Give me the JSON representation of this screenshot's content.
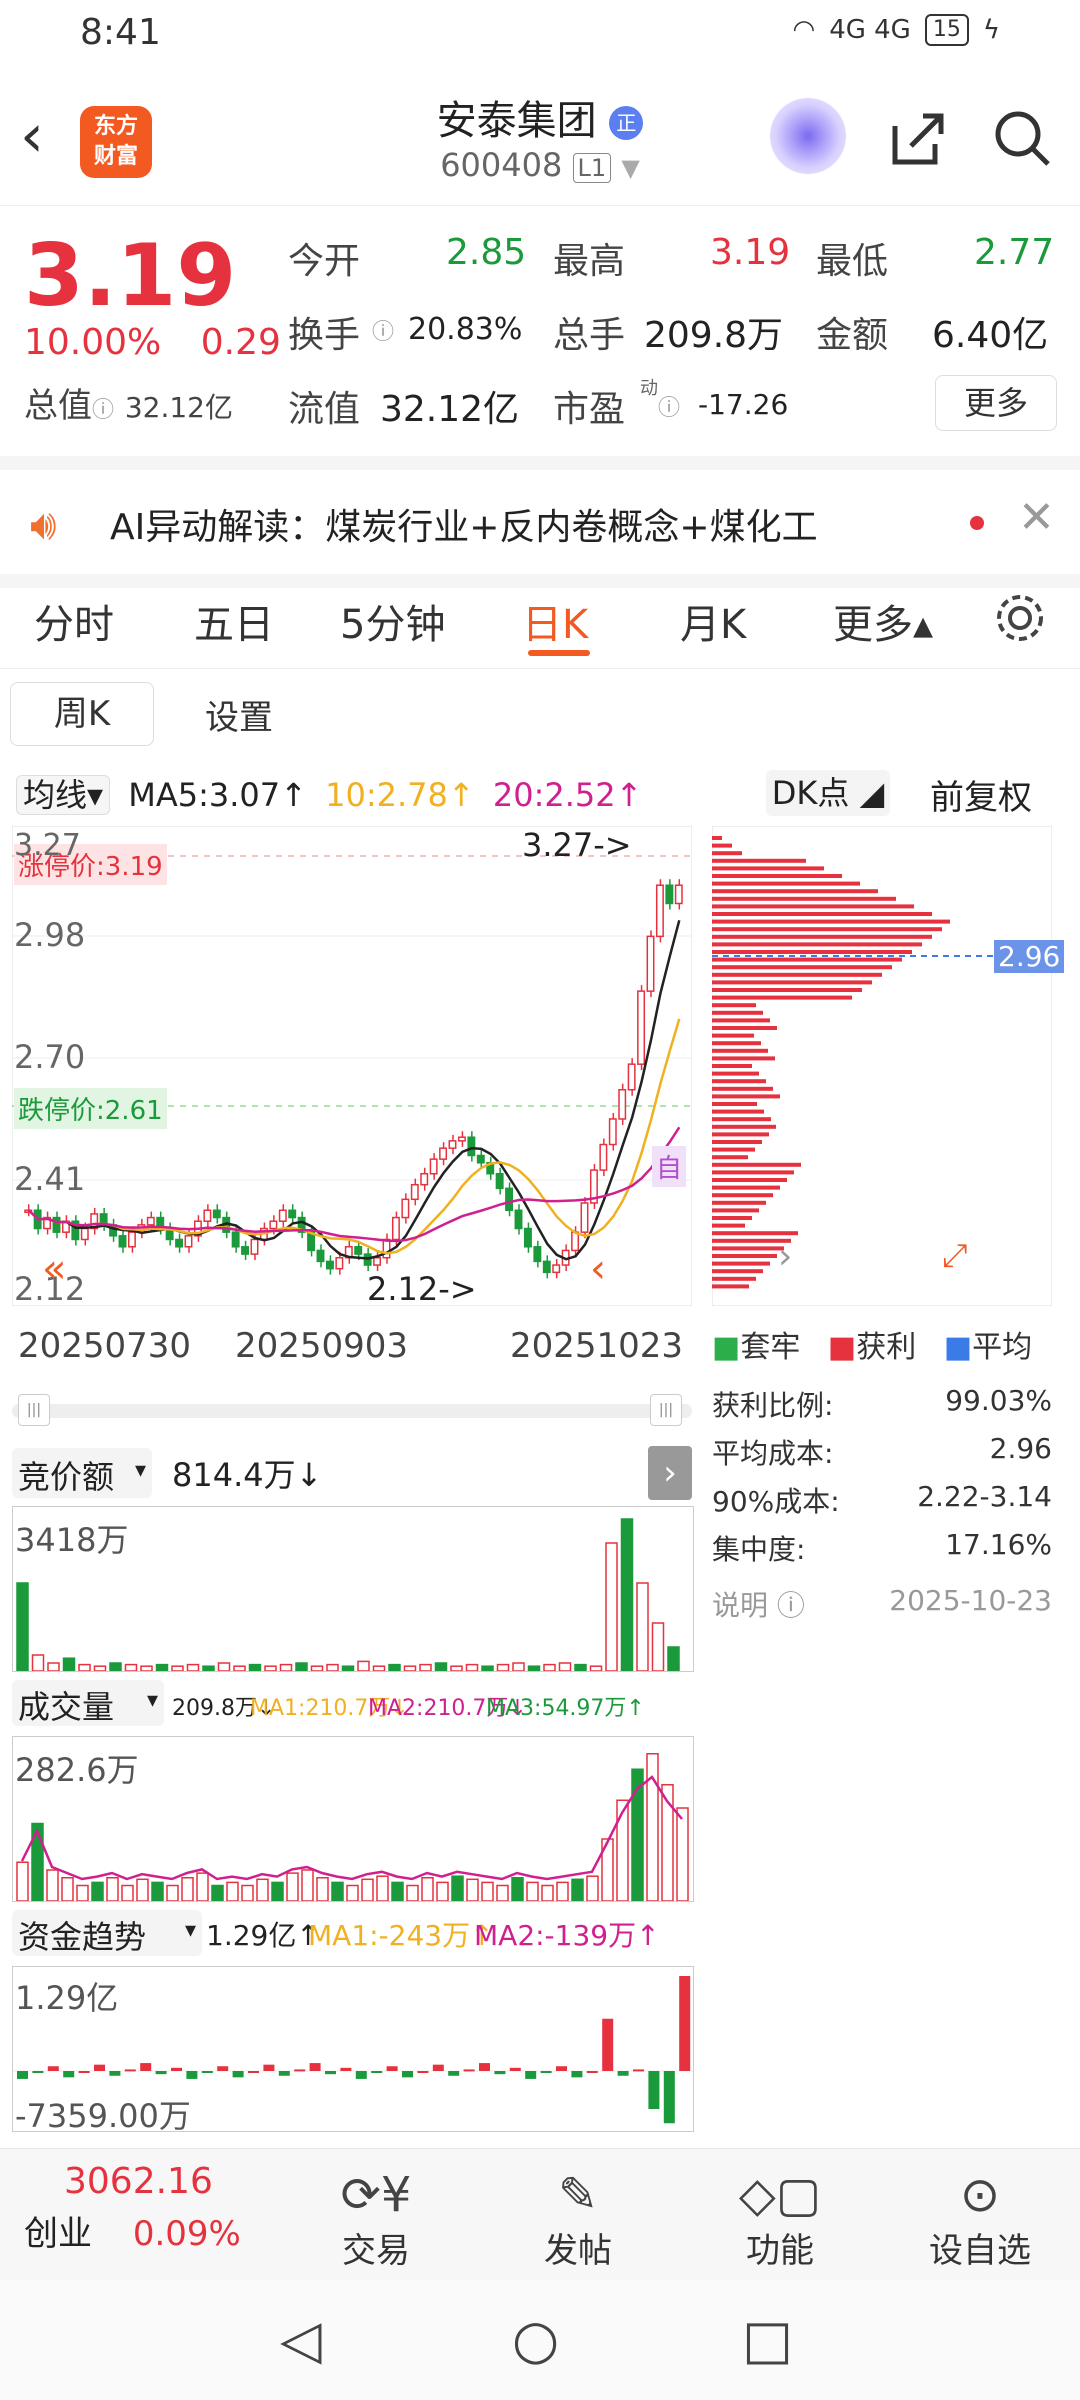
{
  "status_bar": {
    "time": "8:41",
    "network": "4G 4G",
    "battery": "15"
  },
  "header": {
    "logo_text_1": "东方",
    "logo_text_2": "财富",
    "stock_name": "安泰集团",
    "badge": "正",
    "stock_code": "600408",
    "market_tag": "L1"
  },
  "quote": {
    "price": "3.19",
    "change_pct": "10.00%",
    "change_amt": "0.29",
    "total_value_label": "总值",
    "total_value": "32.12亿",
    "open_label": "今开",
    "open": "2.85",
    "high_label": "最高",
    "high": "3.19",
    "low_label": "最低",
    "low": "2.77",
    "turnover_label": "换手",
    "turnover": "20.83%",
    "volume_label": "总手",
    "volume": "209.8万",
    "amount_label": "金额",
    "amount": "6.40亿",
    "float_label": "流值",
    "float_value": "32.12亿",
    "pe_label": "市盈",
    "pe_sup": "动",
    "pe": "-17.26",
    "more": "更多"
  },
  "ai_banner": {
    "text": "AI异动解读：煤炭行业+反内卷概念+煤化工"
  },
  "tabs": [
    {
      "label": "分时"
    },
    {
      "label": "五日"
    },
    {
      "label": "5分钟"
    },
    {
      "label": "日K"
    },
    {
      "label": "月K"
    },
    {
      "label": "更多▴"
    }
  ],
  "subtabs": {
    "week": "周K",
    "settings": "设置"
  },
  "ma": {
    "selector": "均线",
    "ma5": "MA5:3.07↑",
    "ma10": "10:2.78↑",
    "ma20": "20:2.52↑",
    "dk": "DK点",
    "fq": "前复权"
  },
  "kline": {
    "limit_up": "涨停价:3.19",
    "limit_down": "跌停价:2.61",
    "y_labels": [
      "3.27",
      "2.98",
      "2.70",
      "2.41",
      "2.12"
    ],
    "high_mark": "3.27->",
    "low_mark": "2.12->",
    "dates": [
      "20250730",
      "20250903",
      "20251023"
    ],
    "dist_label": "2.96",
    "self_tag": "自"
  },
  "chips": {
    "legend": [
      "套牢",
      "获利",
      "平均"
    ],
    "legend_colors": [
      "#2cae4a",
      "#e5323e",
      "#3b7be8"
    ],
    "stats": [
      {
        "label": "获利比例:",
        "value": "99.03%"
      },
      {
        "label": "平均成本:",
        "value": "2.96"
      },
      {
        "label": "90%成本:",
        "value": "2.22-3.14"
      },
      {
        "label": "集中度:",
        "value": "17.16%"
      }
    ],
    "note_label": "说明",
    "note_date": "2025-10-23"
  },
  "bid": {
    "label": "竞价额",
    "value": "814.4万↓",
    "max": "3418万"
  },
  "volume_chart": {
    "label": "成交量",
    "v": "209.8万↓",
    "ma1": "MA1:210.7万↓",
    "ma2": "MA2:210.7万↓",
    "ma3": "MA3:54.97万↑",
    "max": "282.6万"
  },
  "fund_chart": {
    "label": "资金趋势",
    "v": "1.29亿↑",
    "ma1": "MA1:-243万↑",
    "ma2": "MA2:-139万↑",
    "max": "1.29亿",
    "min": "-7359.00万"
  },
  "bottom_nav": {
    "index_value": "3062.16",
    "index_name": "创业",
    "index_pct": "0.09%",
    "trade": "交易",
    "post": "发帖",
    "func": "功能",
    "watch": "设自选"
  }
}
